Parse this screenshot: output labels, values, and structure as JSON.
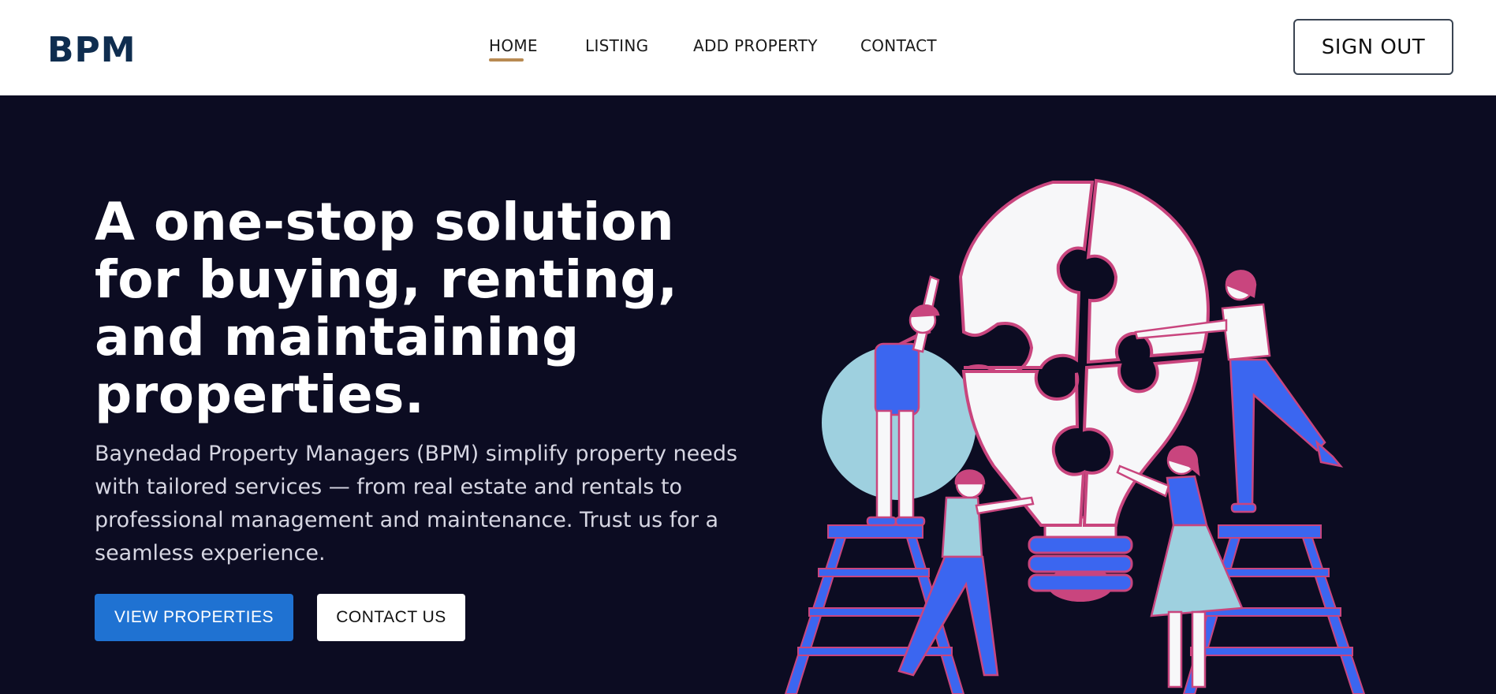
{
  "header": {
    "logo": "BPM",
    "nav": [
      {
        "label": "HOME",
        "active": true
      },
      {
        "label": "LISTING",
        "active": false
      },
      {
        "label": "ADD PROPERTY",
        "active": false
      },
      {
        "label": "CONTACT",
        "active": false
      }
    ],
    "signout_label": "SIGN OUT"
  },
  "hero": {
    "headline": "A one-stop solution for buying, renting, and maintaining properties.",
    "subtext": "Baynedad Property Managers (BPM) simplify property needs with tailored services — from real estate and rentals to professional management and maintenance. Trust us for a seamless experience.",
    "primary_button": "VIEW PROPERTIES",
    "secondary_button": "CONTACT US",
    "illustration_icon": "lightbulb-puzzle-team-illustration"
  },
  "colors": {
    "header_bg": "#ffffff",
    "hero_bg": "#0c0c22",
    "logo": "#0f2d4f",
    "nav_underline": "#b88a52",
    "primary": "#1f72d2",
    "illustration_blue": "#3b66f0",
    "illustration_pink": "#c9457e",
    "illustration_lightblue": "#9ed0df"
  }
}
